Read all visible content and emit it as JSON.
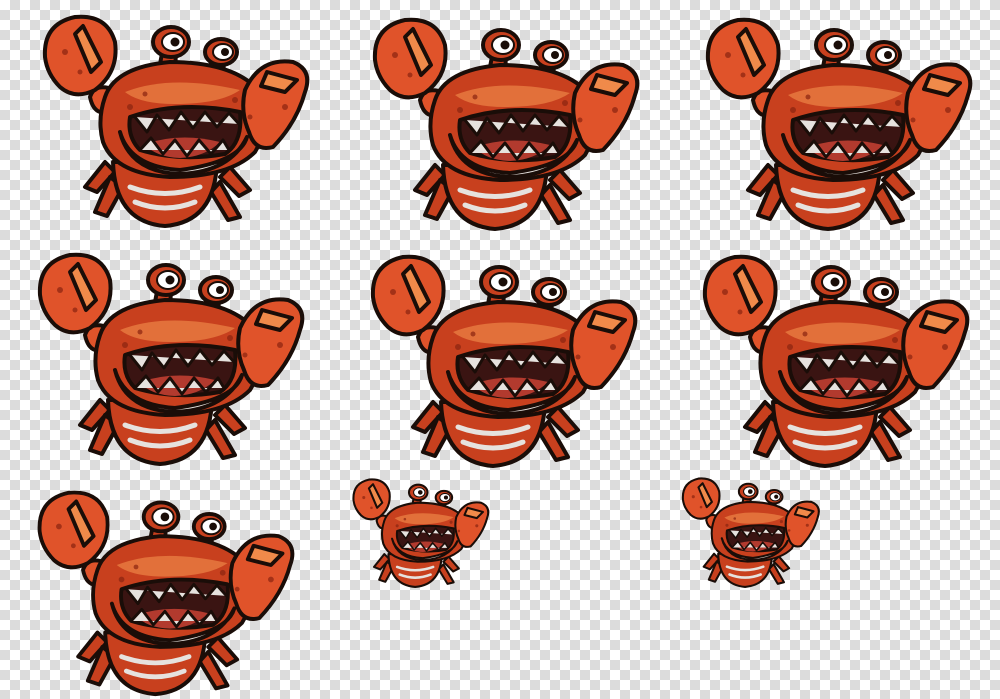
{
  "spritesheet": {
    "background": "transparency-checkerboard",
    "palette": {
      "shell": "#c8401e",
      "shell_dark": "#8a2410",
      "claw": "#e0532a",
      "claw_light": "#f08a4a",
      "belly": "#e6e2de",
      "mouth": "#3a1412",
      "tongue": "#b23a2e",
      "outline": "#1a0d08",
      "eye": "#ffffff",
      "pupil": "#1a0d08"
    },
    "frames": [
      {
        "icon": "crab-monster-icon"
      },
      {
        "icon": "crab-monster-icon"
      },
      {
        "icon": "crab-monster-icon"
      },
      {
        "icon": "crab-monster-icon"
      },
      {
        "icon": "crab-monster-icon"
      },
      {
        "icon": "crab-monster-icon"
      },
      {
        "icon": "crab-monster-icon"
      },
      {
        "icon": "crab-monster-icon"
      },
      {
        "icon": "crab-monster-icon"
      }
    ]
  }
}
